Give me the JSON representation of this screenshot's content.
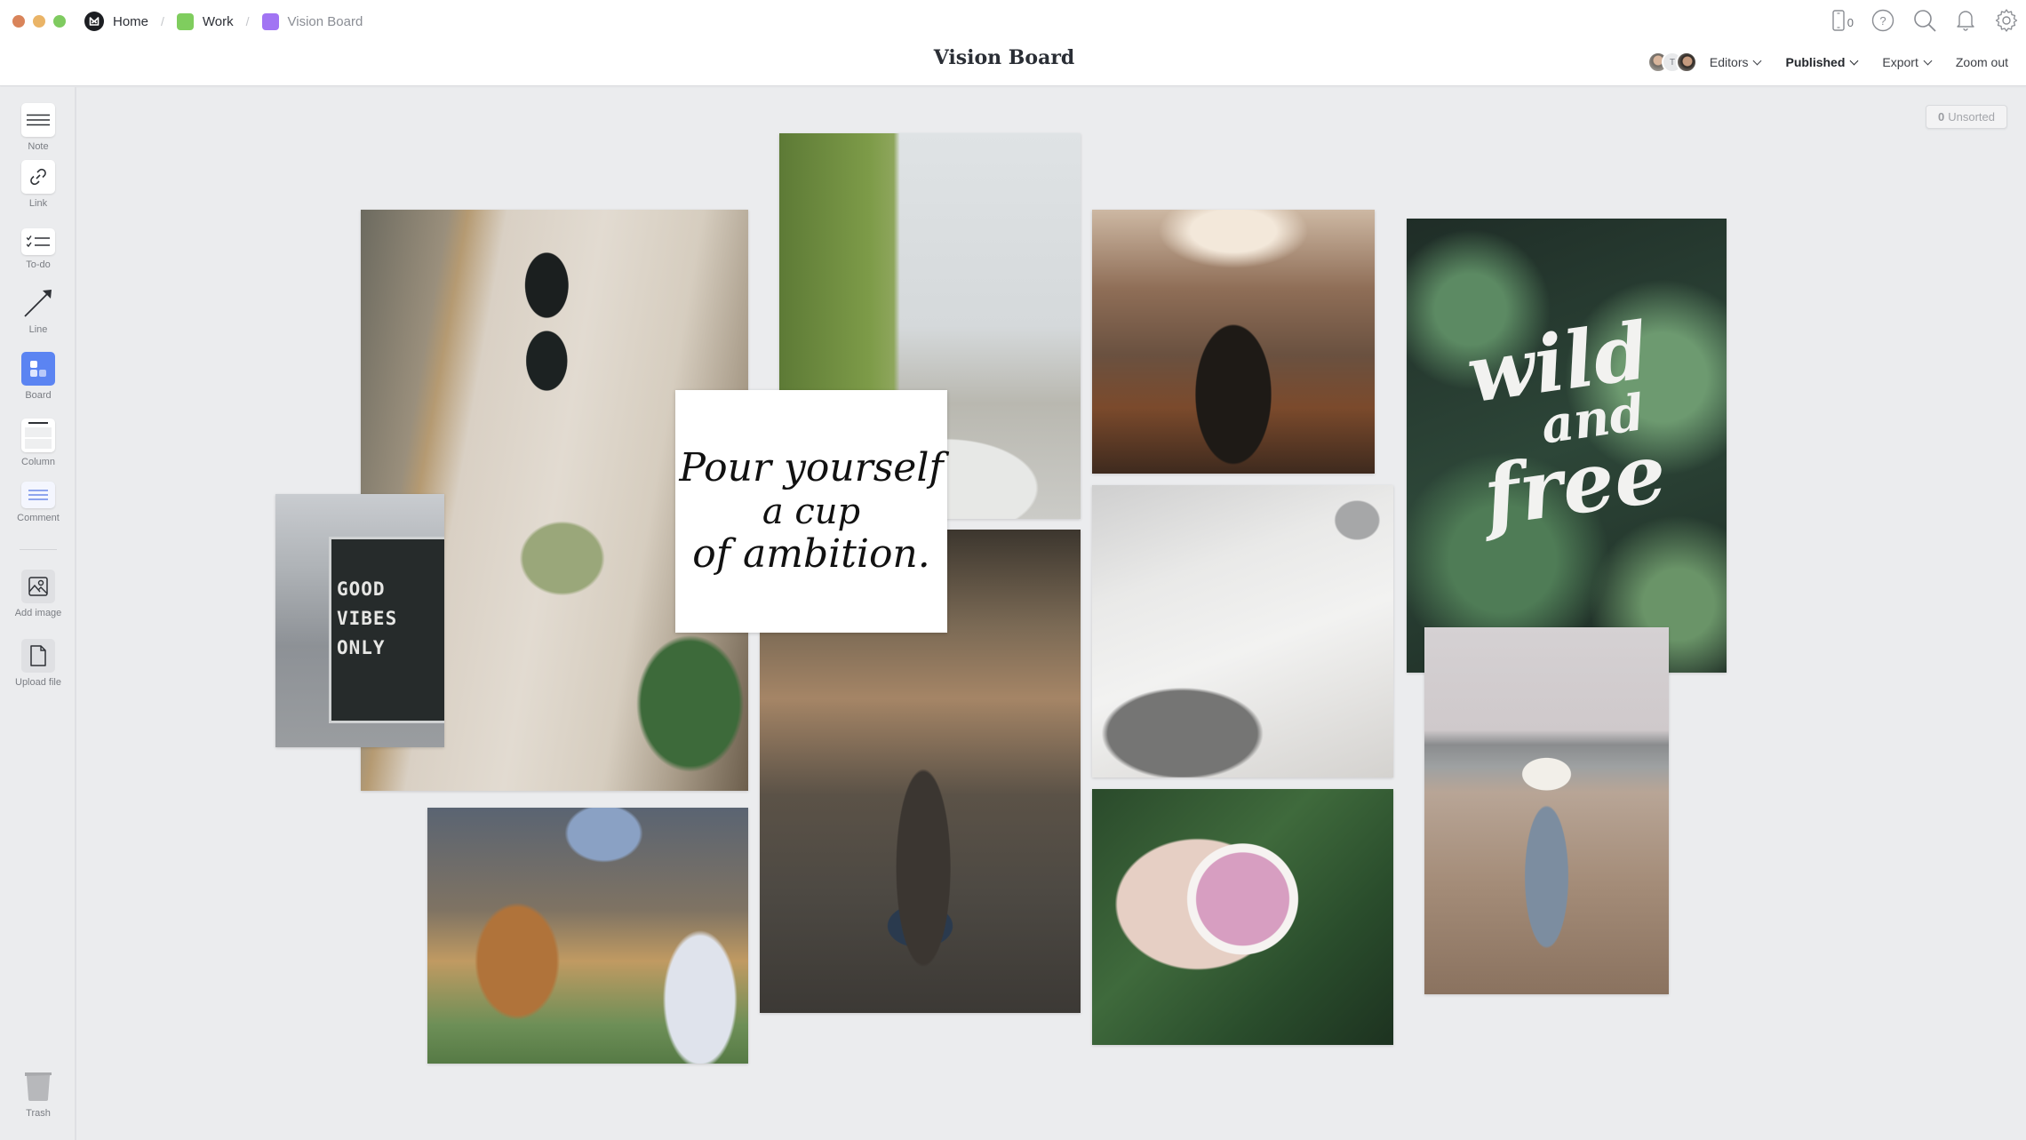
{
  "window": {
    "traffic_lights": [
      "#d9845a",
      "#eab467",
      "#7fcb60"
    ]
  },
  "breadcrumb": [
    {
      "label": "Home",
      "icon": "milanote-logo-icon"
    },
    {
      "label": "Work",
      "color": "#7fcd5e"
    },
    {
      "label": "Vision Board",
      "color": "#a174f3"
    }
  ],
  "header": {
    "title": "Vision Board",
    "device_count": "0",
    "icons": [
      "mobile-device-icon",
      "help-icon",
      "search-icon",
      "bell-icon",
      "gear-icon"
    ],
    "avatars": [
      {
        "type": "photo",
        "name": "editor-1"
      },
      {
        "type": "initial",
        "initial": "T"
      },
      {
        "type": "photo",
        "name": "editor-3"
      }
    ],
    "editors_label": "Editors",
    "published_label": "Published",
    "export_label": "Export",
    "zoom_label": "Zoom out"
  },
  "sidebar": {
    "tools": [
      {
        "label": "Note",
        "icon": "note-icon"
      },
      {
        "label": "Link",
        "icon": "link-icon"
      },
      {
        "label": "To-do",
        "icon": "todo-icon"
      },
      {
        "label": "Line",
        "icon": "line-arrow-icon"
      },
      {
        "label": "Board",
        "icon": "board-icon"
      },
      {
        "label": "Column",
        "icon": "column-icon"
      },
      {
        "label": "Comment",
        "icon": "comment-icon"
      },
      {
        "label": "Add image",
        "icon": "image-icon"
      },
      {
        "label": "Upload file",
        "icon": "file-icon"
      },
      {
        "label": "Trash",
        "icon": "trash-icon"
      }
    ],
    "accent": "#5b84f2"
  },
  "canvas": {
    "unsorted": {
      "count": "0",
      "label": "Unsorted"
    },
    "note": {
      "lines": [
        "Pour yourself",
        "a cup",
        "of ambition."
      ]
    },
    "images": [
      {
        "name": "outfit-smoothie-photo"
      },
      {
        "name": "good-vibes-letterboard-photo",
        "text_lines": [
          "GOOD",
          "VIBES",
          "ONLY"
        ]
      },
      {
        "name": "vintage-car-palms-photo"
      },
      {
        "name": "yoga-sunset-photo"
      },
      {
        "name": "wild-and-free-fern-photo",
        "text_lines": [
          "wild",
          "and",
          "free"
        ]
      },
      {
        "name": "writing-notebook-photo"
      },
      {
        "name": "smoothie-bowl-leaves-photo"
      },
      {
        "name": "woman-open-arms-photo"
      },
      {
        "name": "beach-couple-photo"
      },
      {
        "name": "dog-and-girl-photo"
      }
    ]
  }
}
